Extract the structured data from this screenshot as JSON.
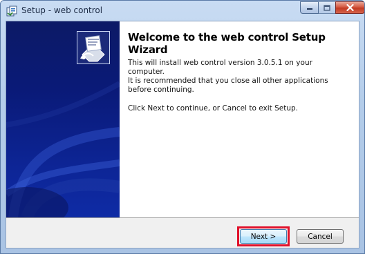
{
  "window": {
    "title": "Setup - web control",
    "icons": {
      "app": "setup-app-icon",
      "minimize": "minimize-icon",
      "maximize": "maximize-icon",
      "close": "close-icon"
    }
  },
  "wizard": {
    "side_image": "setup-wizard-banner-icon",
    "heading": "Welcome to the web control Setup Wizard",
    "paragraphs": [
      "This will install web control version 3.0.5.1 on your computer.",
      "It is recommended that you close all other applications before continuing.",
      "Click Next to continue, or Cancel to exit Setup."
    ]
  },
  "buttons": {
    "next": "Next >",
    "cancel": "Cancel"
  },
  "colors": {
    "title_bar": "#b4cdea",
    "side_panel": "#0a1a78",
    "highlight_box": "#e0102a",
    "close_button": "#c23a22"
  }
}
